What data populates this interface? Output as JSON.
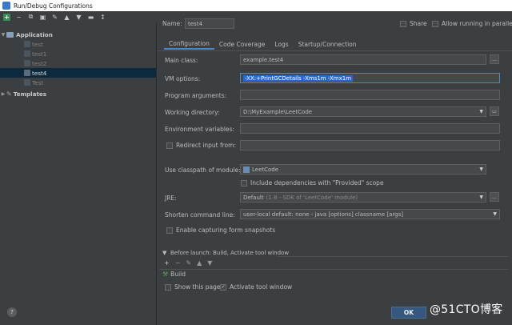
{
  "window": {
    "title": "Run/Debug Configurations"
  },
  "toolbar": {
    "icons": [
      "add-icon",
      "remove-icon",
      "copy-icon",
      "save-icon",
      "wrench-icon",
      "move-up-icon",
      "move-down-icon",
      "folder-icon",
      "sort-icon"
    ]
  },
  "tree": {
    "application_label": "Application",
    "items": [
      "test",
      "test1",
      "test2",
      "test4",
      "Test"
    ],
    "selected": "test4",
    "templates_label": "Templates"
  },
  "header": {
    "name_label": "Name:",
    "name_value": "test4",
    "share_label": "Share",
    "parallel_label": "Allow running in parallel"
  },
  "tabs": [
    "Configuration",
    "Code Coverage",
    "Logs",
    "Startup/Connection"
  ],
  "active_tab": "Configuration",
  "form": {
    "main_class_label": "Main class:",
    "main_class_value": "example.test4",
    "vm_options_label": "VM options:",
    "vm_options_value": "-XX:+PrintGCDetails -Xms1m -Xmx1m",
    "program_args_label": "Program arguments:",
    "program_args_value": "",
    "working_dir_label": "Working directory:",
    "working_dir_value": "D:\\MyExample\\LeetCode",
    "env_vars_label": "Environment variables:",
    "env_vars_value": "",
    "redirect_label": "Redirect input from:",
    "redirect_value": "",
    "classpath_label": "Use classpath of module:",
    "classpath_value": "LeetCode",
    "include_provided_label": "Include dependencies with \"Provided\" scope",
    "jre_label": "JRE:",
    "jre_value_main": "Default",
    "jre_value_detail": "(1.8 - SDK of 'LeetCode' module)",
    "shorten_label": "Shorten command line:",
    "shorten_value": "user-local default: none - java [options] classname [args]",
    "snapshots_label": "Enable capturing form snapshots"
  },
  "before_launch": {
    "header": "Before launch: Build, Activate tool window",
    "item": "Build",
    "show_page_label": "Show this page",
    "activate_label": "Activate tool window",
    "activate_checked": true,
    "show_page_checked": false
  },
  "footer": {
    "help": "?",
    "ok_label": "OK"
  },
  "watermark": "@51CTO博客"
}
